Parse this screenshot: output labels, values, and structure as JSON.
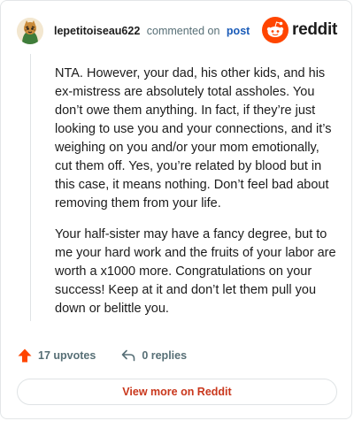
{
  "comment": {
    "username": "lepetitoiseau622",
    "action_text": "commented on",
    "post_link": "post",
    "paragraphs": [
      "NTA. However, your dad, his other kids, and his ex-mistress are absolutely total assholes. You don’t owe them anything. In fact, if they’re just looking to use you and your connections, and it’s weighing on you and/or your mom emotionally, cut them off. Yes, you’re related by blood but in this case, it means nothing. Don’t feel bad about removing them from your life.",
      "Your half-sister may have a fancy degree, but to me your hard work and the fruits of your labor are worth a x1000 more. Congratulations on your success! Keep at it and don’t let them pull you down or belittle you."
    ],
    "upvotes": "17 upvotes",
    "replies": "0 replies"
  },
  "brand": {
    "name": "reddit",
    "accent": "#ff4500"
  },
  "cta": {
    "label": "View more on Reddit",
    "color": "#c9371c"
  },
  "icons": {
    "avatar": "avatar-icon",
    "logo": "reddit-logo-icon",
    "upvote": "upvote-arrow-icon",
    "reply": "reply-arrow-icon"
  }
}
